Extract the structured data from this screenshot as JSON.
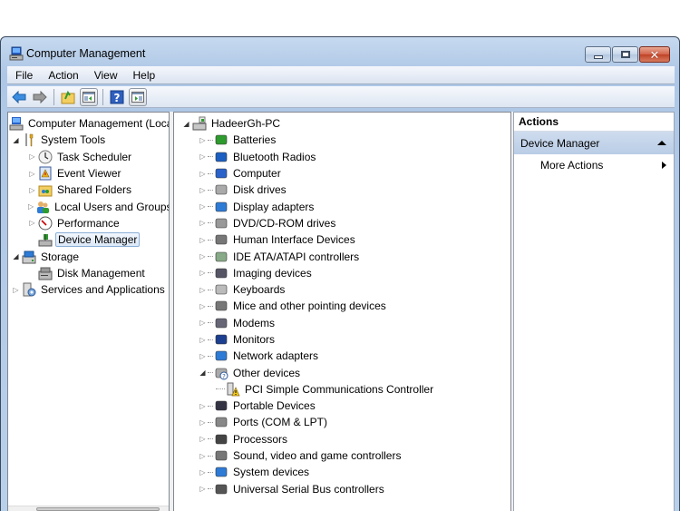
{
  "window": {
    "title": "Computer Management",
    "controls": {
      "minimize": "minimize",
      "maximize": "maximize",
      "close": "✕"
    }
  },
  "menu": [
    "File",
    "Action",
    "View",
    "Help"
  ],
  "toolbar": {
    "buttons": [
      "back-arrow",
      "forward-arrow",
      "up-folder",
      "show-hide-console-tree",
      "help",
      "show-hide-action-pane"
    ]
  },
  "left_tree": {
    "root": "Computer Management (Local)",
    "system_tools": "System Tools",
    "task_scheduler": "Task Scheduler",
    "event_viewer": "Event Viewer",
    "shared_folders": "Shared Folders",
    "local_users": "Local Users and Groups",
    "performance": "Performance",
    "device_manager": "Device Manager",
    "storage": "Storage",
    "disk_management": "Disk Management",
    "services": "Services and Applications"
  },
  "device_tree": {
    "root": "HadeerGh-PC",
    "categories": [
      "Batteries",
      "Bluetooth Radios",
      "Computer",
      "Disk drives",
      "Display adapters",
      "DVD/CD-ROM drives",
      "Human Interface Devices",
      "IDE ATA/ATAPI controllers",
      "Imaging devices",
      "Keyboards",
      "Mice and other pointing devices",
      "Modems",
      "Monitors",
      "Network adapters",
      "Other devices",
      "Portable Devices",
      "Ports (COM & LPT)",
      "Processors",
      "Sound, video and game controllers",
      "System devices",
      "Universal Serial Bus controllers"
    ],
    "other_devices_child": "PCI Simple Communications Controller"
  },
  "actions": {
    "header": "Actions",
    "group": "Device Manager",
    "item": "More Actions"
  },
  "colors": {
    "title_gradient_top": "#c6d9ef",
    "selection_border": "#8aaed6",
    "close_button": "#c04327",
    "actions_group_bg": "#c4d5eb"
  }
}
